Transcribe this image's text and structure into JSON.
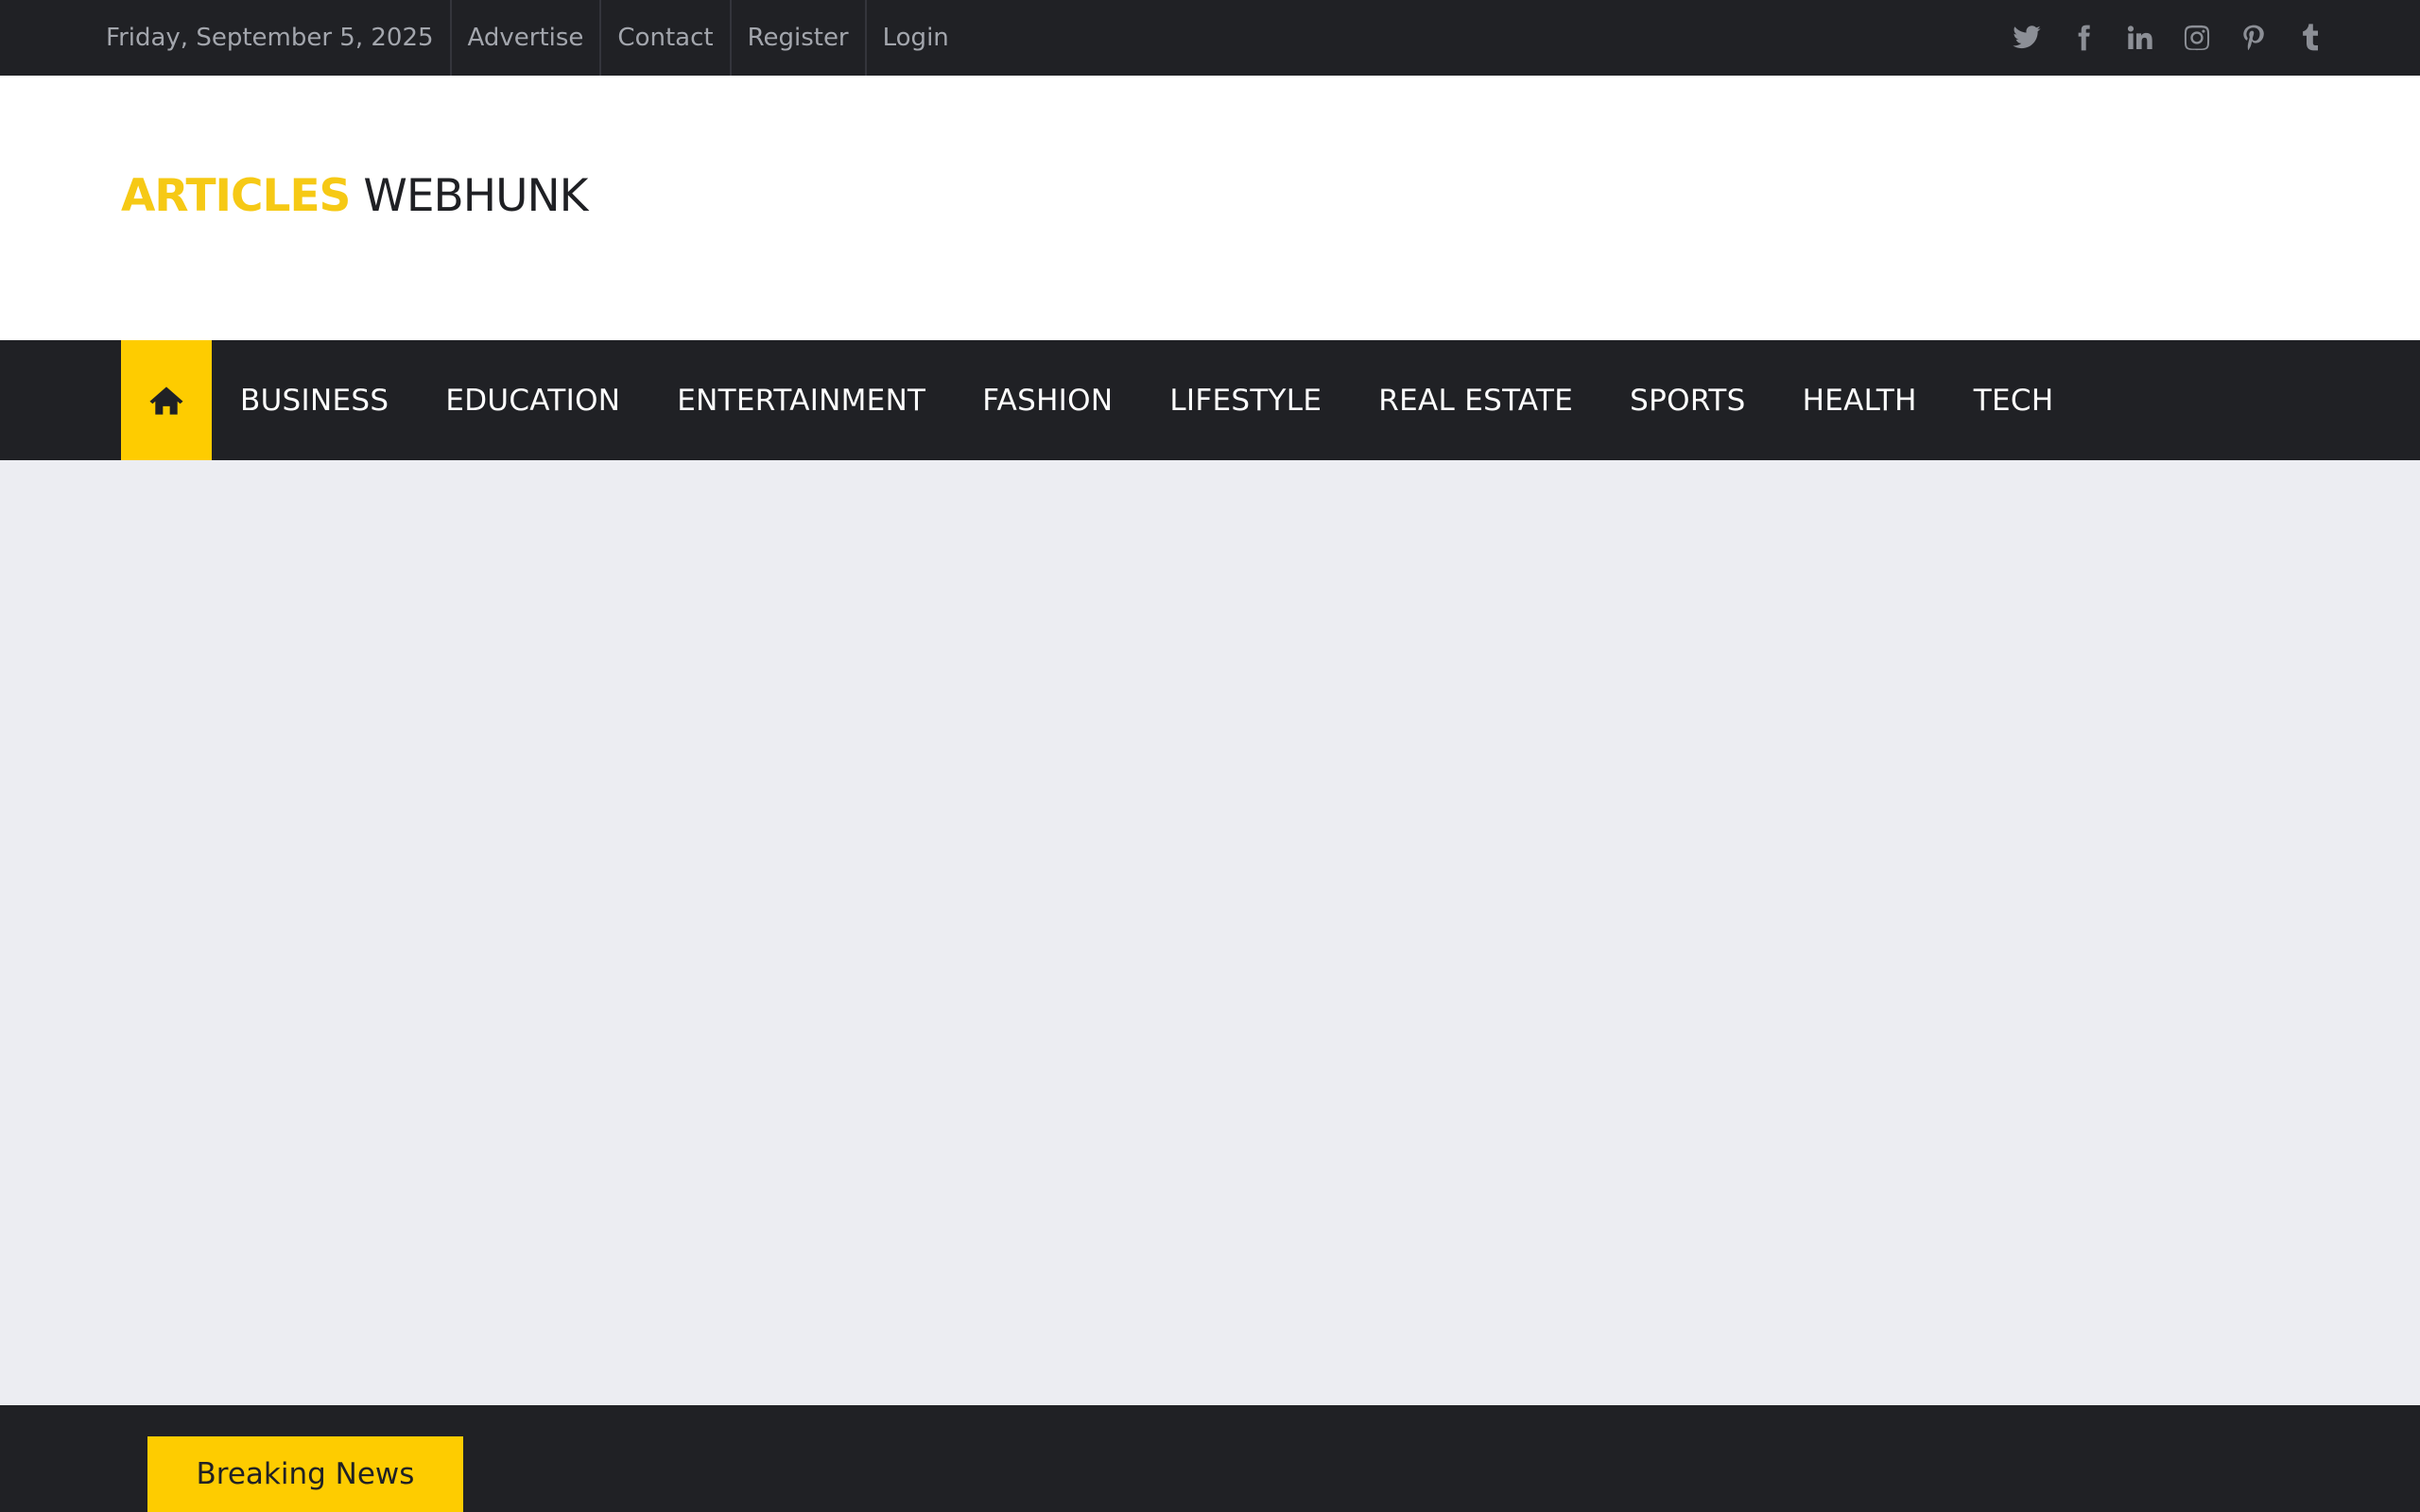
{
  "topbar": {
    "date": "Friday, September 5, 2025",
    "links": [
      "Advertise",
      "Contact",
      "Register",
      "Login"
    ],
    "socials": [
      "twitter-icon",
      "facebook-icon",
      "linkedin-icon",
      "instagram-icon",
      "pinterest-icon",
      "tumblr-icon"
    ]
  },
  "logo": {
    "part1": "ARTICLES",
    "part2": "WEBHUNK"
  },
  "nav": {
    "home_icon": "home-icon",
    "items": [
      "BUSINESS",
      "EDUCATION",
      "ENTERTAINMENT",
      "FASHION",
      "LIFESTYLE",
      "REAL ESTATE",
      "SPORTS",
      "HEALTH",
      "TECH"
    ]
  },
  "ticker": {
    "label": "Breaking News"
  },
  "colors": {
    "accent": "#fecc00",
    "dark": "#202125",
    "background": "#ecedf2"
  }
}
